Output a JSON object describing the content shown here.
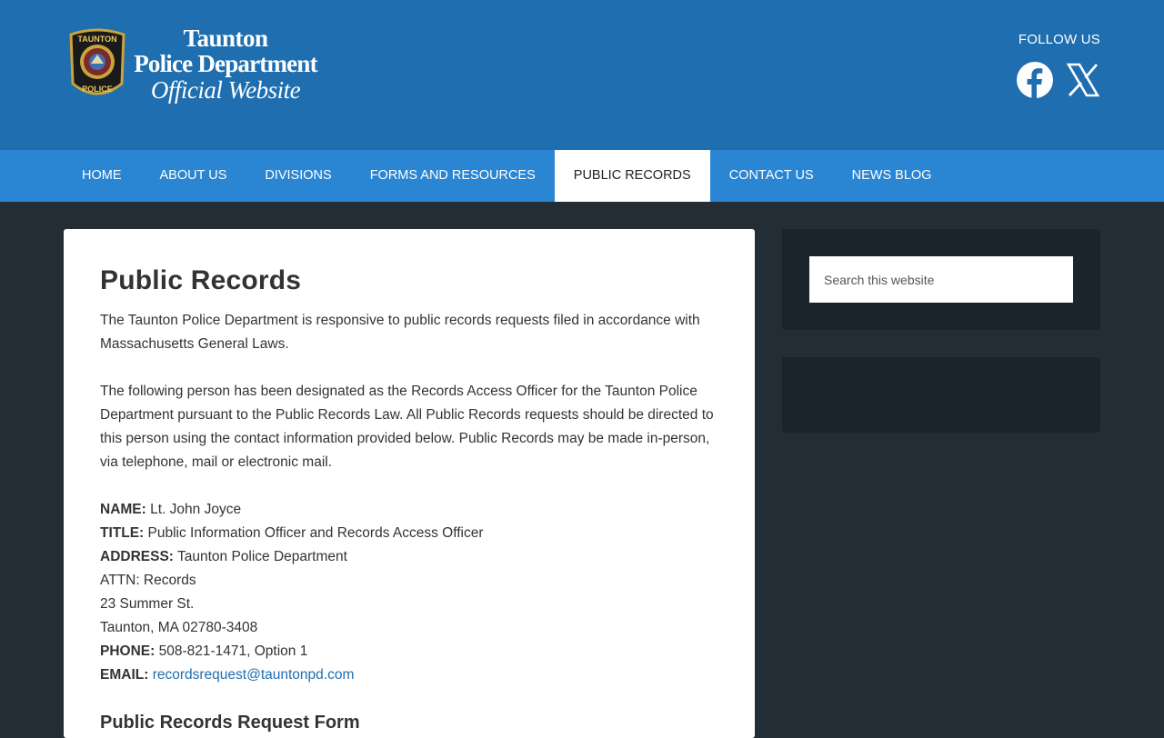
{
  "header": {
    "badge_top": "TAUNTON",
    "badge_bottom": "POLICE",
    "logo_line1": "Taunton",
    "logo_line2": "Police Department",
    "logo_line3": "Official Website",
    "follow_label": "FOLLOW US",
    "social": [
      {
        "icon": "facebook-icon"
      },
      {
        "icon": "x-twitter-icon"
      }
    ]
  },
  "nav": {
    "items": [
      {
        "label": "HOME"
      },
      {
        "label": "ABOUT US"
      },
      {
        "label": "DIVISIONS"
      },
      {
        "label": "FORMS AND RESOURCES"
      },
      {
        "label": "PUBLIC RECORDS",
        "active": true
      },
      {
        "label": "CONTACT US"
      },
      {
        "label": "NEWS BLOG"
      }
    ]
  },
  "main": {
    "title": "Public Records",
    "para1": "The Taunton Police Department is responsive to public records requests filed in accordance with Massachusetts General Laws.",
    "para2": "The following person has been designated as the Records Access Officer for the Taunton Police Department pursuant to the Public Records Law. All Public Records requests should be directed to this person using the contact information provided below. Public Records may be made in-person, via telephone, mail or electronic mail.",
    "contact": {
      "name_label": "NAME:",
      "name_value": " Lt. John Joyce",
      "title_label": "TITLE:",
      "title_value": " Public Information Officer and Records Access Officer",
      "address_label": "ADDRESS:",
      "address_value": " Taunton Police Department",
      "address_line2": "ATTN: Records",
      "address_line3": "23 Summer St.",
      "address_line4": "Taunton, MA 02780-3408",
      "phone_label": "PHONE:",
      "phone_value": " 508-821-1471, Option 1",
      "email_label": "EMAIL:",
      "email_value": "recordsrequest@tauntonpd.com"
    },
    "form_heading": "Public Records Request Form"
  },
  "sidebar": {
    "search_placeholder": "Search this website"
  },
  "colors": {
    "header_bg": "#1f6eb0",
    "nav_bg": "#2a86d3",
    "page_bg": "#232d36",
    "widget_bg": "#1b232b",
    "link": "#1f6eb0"
  }
}
